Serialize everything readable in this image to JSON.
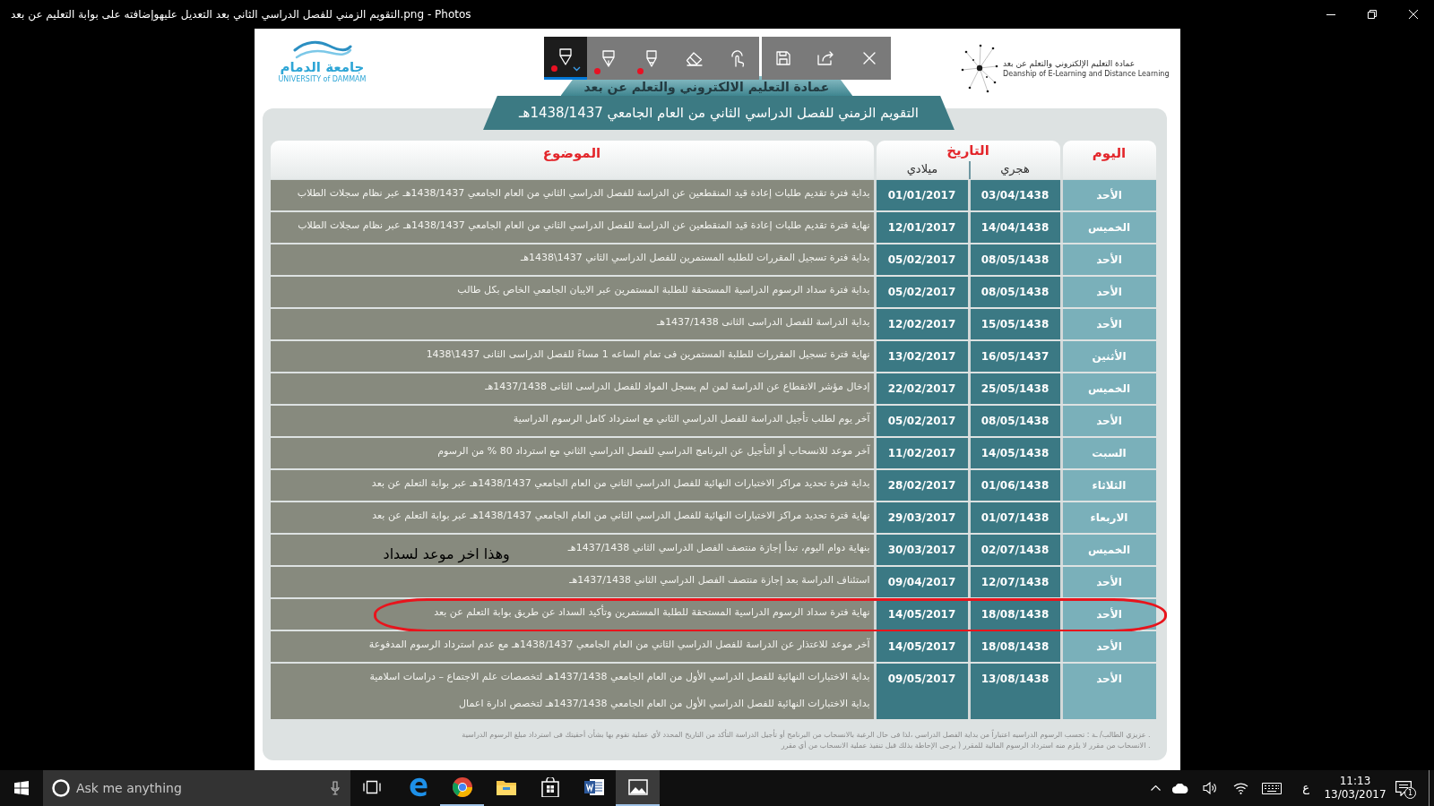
{
  "window": {
    "title": "التقويم الزمني للفصل الدراسي الثاني بعد التعديل عليهوإضافته على بوابة التعليم عن بعد.png - Photos"
  },
  "ink_toolbar": {
    "tools": [
      {
        "kind": "ballpoint-pen",
        "selected": true
      },
      {
        "kind": "calligraphy-pen",
        "selected": false
      },
      {
        "kind": "pencil",
        "selected": false
      },
      {
        "kind": "eraser",
        "selected": false
      },
      {
        "kind": "touch-writing",
        "selected": false
      }
    ],
    "actions": [
      {
        "kind": "save"
      },
      {
        "kind": "share"
      },
      {
        "kind": "close"
      }
    ]
  },
  "document": {
    "logo_left": {
      "name": "جامعة الدمام",
      "subtitle": "UNIVERSITY of DAMMAM"
    },
    "logo_right": {
      "name": "عمادة التعليم الإلكتروني والتعلم عن بعد",
      "subtitle": "Deanship of E-Learning and Distance Learning"
    },
    "banner": "عمادة التعليم الالكتروني والتعلم عن بعد",
    "title": "التقويم الزمني للفصل الدراسي الثاني من العام الجامعي 1438/1437هـ",
    "table": {
      "columns": {
        "day": "اليوم",
        "date": "التاريخ",
        "hijri": "هجري",
        "gregorian": "ميلادي",
        "subject": "الموضوع"
      },
      "rows": [
        {
          "day": "الأحد",
          "hijri": "03/04/1438",
          "gregorian": "01/01/2017",
          "subject_lines": [
            "بداية فترة تقديم طلبات إعادة قيد المنقطعين عن الدراسة للفصل الدراسي الثاني من العام الجامعي 1438/1437هـ عبر نظام سجلات الطلاب"
          ],
          "circled": false
        },
        {
          "day": "الخميس",
          "hijri": "14/04/1438",
          "gregorian": "12/01/2017",
          "subject_lines": [
            "نهاية فترة تقديم طلبات إعادة قيد المنقطعين عن الدراسة للفصل الدراسي الثاني من العام الجامعي 1438/1437هـ عبر نظام سجلات الطلاب"
          ],
          "circled": false
        },
        {
          "day": "الأحد",
          "hijri": "08/05/1438",
          "gregorian": "05/02/2017",
          "subject_lines": [
            "بداية فترة تسجيل المقررات للطلبه المستمرين للفصل الدراسي الثاني 1437\\1438هـ"
          ],
          "circled": false
        },
        {
          "day": "الأحد",
          "hijri": "08/05/1438",
          "gregorian": "05/02/2017",
          "subject_lines": [
            "بداية فترة سداد الرسوم الدراسية المستحقة للطلبة المستمرين عبر الايبان الجامعي الخاص بكل طالب"
          ],
          "circled": false
        },
        {
          "day": "الأحد",
          "hijri": "15/05/1438",
          "gregorian": "12/02/2017",
          "subject_lines": [
            "بداية الدراسة للفصل الدراسى الثانى 1437/1438هـ"
          ],
          "circled": false
        },
        {
          "day": "الأثنين",
          "hijri": "16/05/1437",
          "gregorian": "13/02/2017",
          "subject_lines": [
            "نهاية فترة تسجيل المقررات للطلبة المستمرين فى تمام الساعه 1 مساءً للفصل الدراسى الثانى 1437\\1438"
          ],
          "circled": false
        },
        {
          "day": "الخميس",
          "hijri": "25/05/1438",
          "gregorian": "22/02/2017",
          "subject_lines": [
            "إدخال مؤشر الانقطاع عن الدراسة لمن لم يسجل المواد للفصل الدراسى الثانى 1437/1438هـ"
          ],
          "circled": false
        },
        {
          "day": "الأحد",
          "hijri": "08/05/1438",
          "gregorian": "05/02/2017",
          "subject_lines": [
            "آخر يوم لطلب تأجيل الدراسة للفصل الدراسي الثاني مع استرداد كامل الرسوم الدراسية"
          ],
          "circled": false
        },
        {
          "day": "السبت",
          "hijri": "14/05/1438",
          "gregorian": "11/02/2017",
          "subject_lines": [
            "آخر موعد للانسحاب أو التأجيل عن البرنامج الدراسي للفصل الدراسي الثاني مع استرداد 80 % من الرسوم"
          ],
          "circled": false
        },
        {
          "day": "الثلاثاء",
          "hijri": "01/06/1438",
          "gregorian": "28/02/2017",
          "subject_lines": [
            "بداية فترة تحديد مراكز الاختبارات النهائية للفصل الدراسي الثاني من العام الجامعي 1438/1437هـ عبر بوابة التعلم عن بعد"
          ],
          "circled": false
        },
        {
          "day": "الاربعاء",
          "hijri": "01/07/1438",
          "gregorian": "29/03/2017",
          "subject_lines": [
            "نهاية فترة تحديد مراكز الاختبارات النهائية للفصل الدراسي الثاني من العام الجامعي 1438/1437هـ عبر بوابة التعلم عن بعد"
          ],
          "circled": false
        },
        {
          "day": "الخميس",
          "hijri": "02/07/1438",
          "gregorian": "30/03/2017",
          "subject_lines": [
            "بنهاية دوام اليوم، تبدأ إجازة منتصف الفصل الدراسي الثاني 1437/1438هـ"
          ],
          "circled": false
        },
        {
          "day": "الأحد",
          "hijri": "12/07/1438",
          "gregorian": "09/04/2017",
          "subject_lines": [
            "استئناف الدراسة بعد إجازة منتصف الفصل الدراسي الثاني 1437/1438هـ"
          ],
          "circled": false
        },
        {
          "day": "الأحد",
          "hijri": "18/08/1438",
          "gregorian": "14/05/2017",
          "subject_lines": [
            "نهاية فترة سداد الرسوم الدراسية المستحقة للطلبة المستمرين وتأكيد السداد عن طريق بوابة التعلم عن بعد"
          ],
          "circled": true
        },
        {
          "day": "الأحد",
          "hijri": "18/08/1438",
          "gregorian": "14/05/2017",
          "subject_lines": [
            "آخر موعد للاعتذار عن الدراسة للفصل الدراسي الثاني من العام الجامعي 1438/1437هـ مع عدم استرداد الرسوم المدفوعة"
          ],
          "circled": false
        },
        {
          "day": "الأحد",
          "hijri": "13/08/1438",
          "gregorian": "09/05/2017",
          "subject_lines": [
            "بداية الاختبارات النهائية للفصل الدراسي الأول من العام الجامعي 1437/1438هـ لتخصصات علم الاجتماع – دراسات اسلامية",
            "بداية الاختبارات النهائية للفصل الدراسي الأول من العام الجامعي 1437/1438هـ لتخصص ادارة اعمال"
          ],
          "circled": false
        }
      ]
    },
    "handwritten_note": "وهذا اخر موعد لسداد",
    "footnotes": [
      ". عزيزي الطالب/ ـة : تحسب الرسوم الدراسيه اعتباراً من بداية الفصل الدراسي ،لذا فى حال الرغبة بالانسحاب من البرنامج أو تأجيل الدراسة التأكد من التاريخ المحدد لأي عملية تقوم بها بشأن أحقيتك فى استرداد مبلغ الرسوم الدراسية",
      ". الانسحاب من مقرر لا يلزم منه استرداد الرسوم المالية للمقرر ( يرجى الإحاطة بذلك قبل تنفيذ عملية الانسحاب من أي مقرر"
    ]
  },
  "taskbar": {
    "search": {
      "placeholder": "Ask me anything"
    },
    "apps": [
      {
        "kind": "task-view",
        "running": false,
        "selected": false
      },
      {
        "kind": "edge",
        "running": false,
        "selected": false
      },
      {
        "kind": "chrome",
        "running": true,
        "selected": false
      },
      {
        "kind": "explorer",
        "running": false,
        "selected": false
      },
      {
        "kind": "store",
        "running": false,
        "selected": false
      },
      {
        "kind": "word",
        "running": false,
        "selected": false
      },
      {
        "kind": "photos",
        "running": true,
        "selected": true
      }
    ],
    "input_language": "ع",
    "clock": {
      "time": "11:13",
      "date": "13/03/2017"
    },
    "notifications": {
      "count": "1"
    }
  }
}
